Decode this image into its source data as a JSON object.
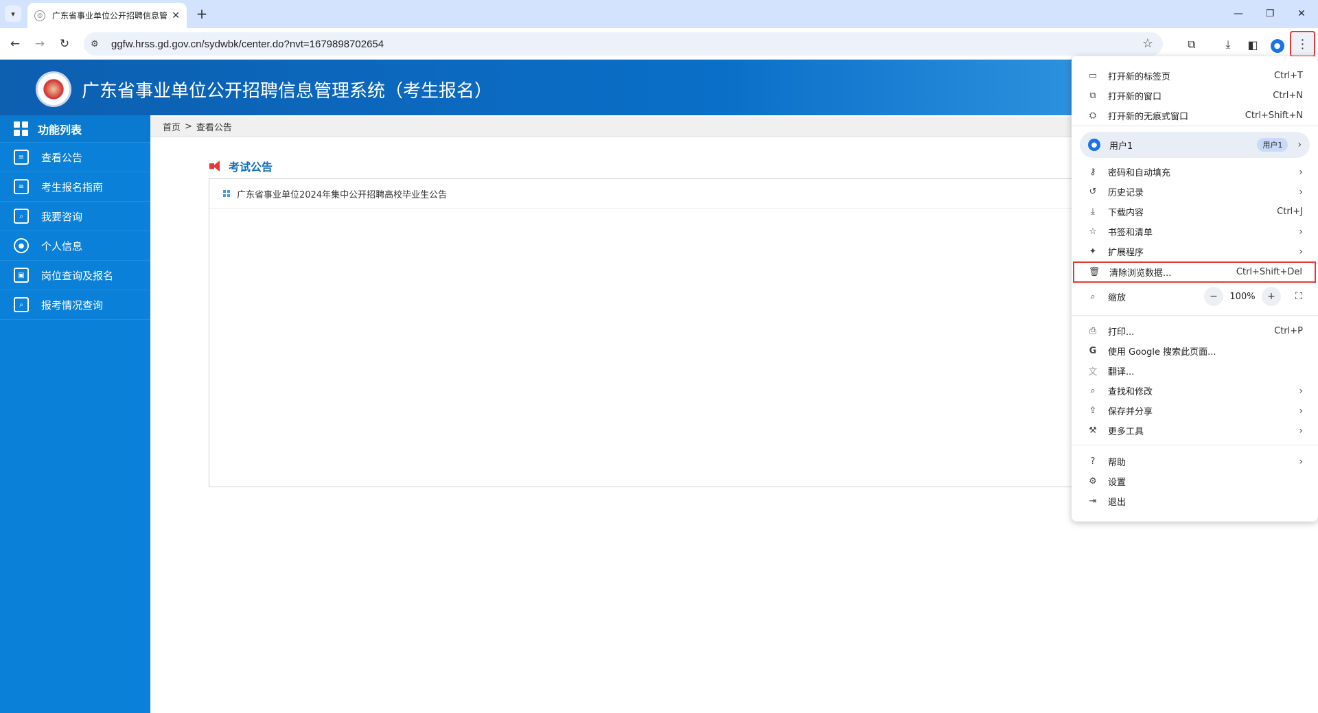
{
  "tab": {
    "title": "广东省事业单位公开招聘信息管"
  },
  "toolbar": {
    "url": "ggfw.hrss.gd.gov.cn/sydwbk/center.do?nvt=1679898702654"
  },
  "header": {
    "title": "广东省事业单位公开招聘信息管理系统（考生报名）"
  },
  "sidebar": {
    "title": "功能列表",
    "items": [
      {
        "label": "查看公告"
      },
      {
        "label": "考生报名指南"
      },
      {
        "label": "我要咨询"
      },
      {
        "label": "个人信息"
      },
      {
        "label": "岗位查询及报名"
      },
      {
        "label": "报考情况查询"
      }
    ]
  },
  "breadcrumb": {
    "home": "首页",
    "separator": ">",
    "current": "查看公告"
  },
  "main": {
    "section_title": "考试公告",
    "notices": [
      {
        "title": "广东省事业单位2024年集中公开招聘高校毕业生公告"
      }
    ]
  },
  "menu": {
    "new_tab": {
      "label": "打开新的标签页",
      "shortcut": "Ctrl+T"
    },
    "new_window": {
      "label": "打开新的窗口",
      "shortcut": "Ctrl+N"
    },
    "incognito": {
      "label": "打开新的无痕式窗口",
      "shortcut": "Ctrl+Shift+N"
    },
    "profile": {
      "label": "用户1",
      "chip": "用户1"
    },
    "passwords": {
      "label": "密码和自动填充"
    },
    "history": {
      "label": "历史记录"
    },
    "downloads": {
      "label": "下载内容",
      "shortcut": "Ctrl+J"
    },
    "bookmarks": {
      "label": "书签和清单"
    },
    "extensions": {
      "label": "扩展程序"
    },
    "clear_data": {
      "label": "清除浏览数据...",
      "shortcut": "Ctrl+Shift+Del"
    },
    "zoom": {
      "label": "缩放",
      "value": "100%"
    },
    "print": {
      "label": "打印...",
      "shortcut": "Ctrl+P"
    },
    "google_search": {
      "label": "使用 Google 搜索此页面..."
    },
    "translate": {
      "label": "翻译..."
    },
    "find": {
      "label": "查找和修改"
    },
    "save_share": {
      "label": "保存并分享"
    },
    "more_tools": {
      "label": "更多工具"
    },
    "help": {
      "label": "帮助"
    },
    "settings": {
      "label": "设置"
    },
    "exit": {
      "label": "退出"
    }
  },
  "colors": {
    "accent_red": "#e53935",
    "sidebar_blue": "#0a80d8",
    "header_blue": "#0d5fb0"
  }
}
